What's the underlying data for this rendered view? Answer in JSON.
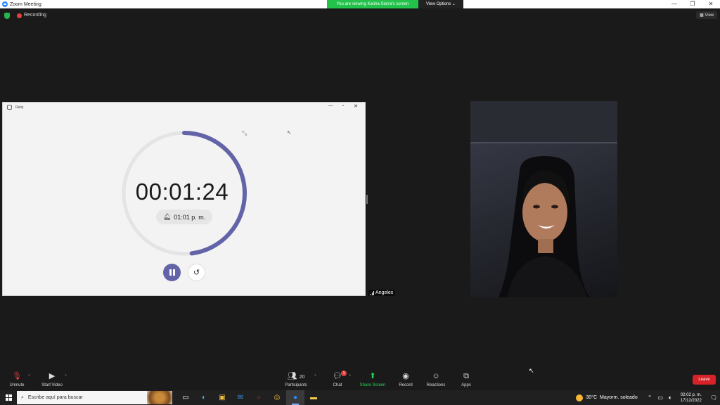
{
  "window": {
    "title": "Zoom Meeting"
  },
  "share_banner": {
    "viewing": "You are viewing Karina Sierra's screen",
    "view_options": "View Options"
  },
  "meeting_bar": {
    "recording": "Recording",
    "view": "View"
  },
  "clock_app": {
    "title": "Reloj",
    "timer": "00:01:24",
    "alarm": "01:01 p. m.",
    "progress_fraction": 0.48,
    "accent": "#6264a7"
  },
  "video": {
    "participant": "Angeles"
  },
  "toolbar": {
    "unmute": "Unmute",
    "start_video": "Start Video",
    "participants": "Participants",
    "participants_count": "20",
    "chat": "Chat",
    "chat_badge": "1",
    "share_screen": "Share Screen",
    "record": "Record",
    "reactions": "Reactions",
    "apps": "Apps",
    "leave": "Leave"
  },
  "taskbar": {
    "search_placeholder": "Escribe aquí para buscar",
    "weather_temp": "30°C",
    "weather_desc": "Mayorm. soleado",
    "time": "02:02 p. m.",
    "date": "17/12/2022"
  },
  "icons": [
    "zoom-logo-icon",
    "shield-icon",
    "record-dot-icon",
    "mic-muted-icon",
    "video-off-icon",
    "participants-icon",
    "chat-icon",
    "share-screen-icon",
    "record-icon",
    "reactions-icon",
    "apps-icon",
    "bell-icon",
    "pause-icon",
    "reset-icon",
    "windows-start-icon",
    "search-icon"
  ]
}
